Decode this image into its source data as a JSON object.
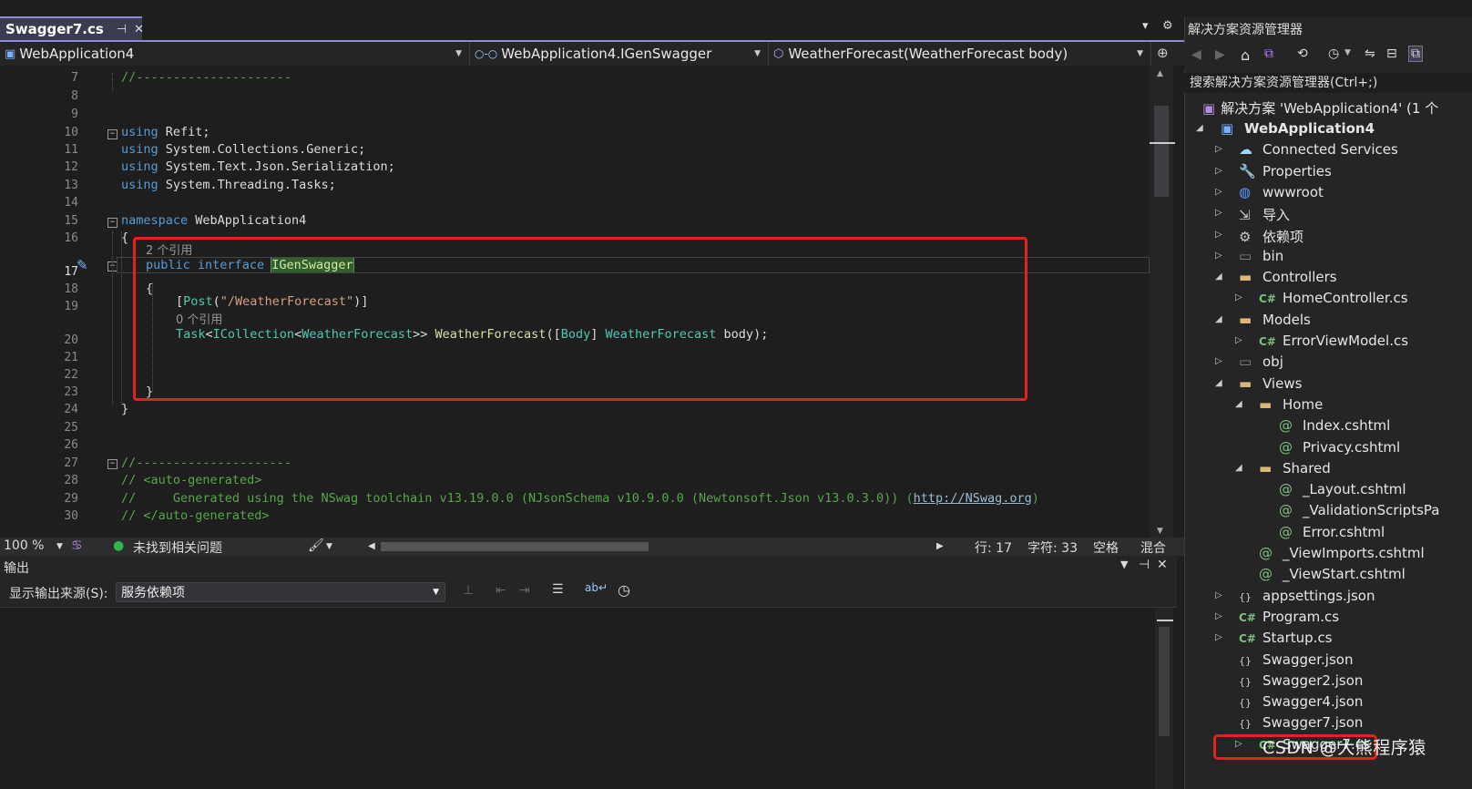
{
  "tabs": [
    {
      "label": "Swagger7.cs",
      "active": true
    }
  ],
  "navbar": {
    "project": "WebApplication4",
    "type": "WebApplication4.IGenSwagger",
    "member": "WeatherForecast(WeatherForecast body)"
  },
  "code": {
    "lines": [
      {
        "n": "7",
        "text": "//---------------------"
      },
      {
        "n": "8",
        "text": ""
      },
      {
        "n": "9",
        "text": ""
      },
      {
        "n": "10",
        "kw": "using",
        "rest": " Refit;"
      },
      {
        "n": "11",
        "kw": "using",
        "rest": " System.Collections.Generic;"
      },
      {
        "n": "12",
        "kw": "using",
        "rest": " System.Text.Json.Serialization;"
      },
      {
        "n": "13",
        "kw": "using",
        "rest": " System.Threading.Tasks;"
      },
      {
        "n": "14",
        "text": ""
      },
      {
        "n": "15",
        "kw": "namespace",
        "rest": " WebApplication4"
      },
      {
        "n": "16",
        "text": "{"
      },
      {
        "n": "17",
        "text": ""
      },
      {
        "n": "18",
        "text": "{"
      },
      {
        "n": "19",
        "text": ""
      },
      {
        "n": "20",
        "text": ""
      },
      {
        "n": "21",
        "text": ""
      },
      {
        "n": "22",
        "text": ""
      },
      {
        "n": "23",
        "text": "}"
      },
      {
        "n": "24",
        "text": "}"
      },
      {
        "n": "25",
        "text": ""
      },
      {
        "n": "26",
        "text": ""
      },
      {
        "n": "27",
        "text": "//---------------------"
      },
      {
        "n": "28",
        "text": "// <auto-generated>"
      },
      {
        "n": "29",
        "text": "//     Generated using the NSwag toolchain v13.19.0.0 (NJsonSchema v10.9.0.0 (Newtonsoft.Json v13.0.3.0)) ("
      },
      {
        "n": "30",
        "text": "// </auto-generated>"
      }
    ],
    "lens_refs_2": "2 个引用",
    "lens_refs_0": "0 个引用",
    "kw_public": "public",
    "kw_interface": "interface",
    "iface_name": "IGenSwagger",
    "attr_post": "Post",
    "attr_route": "\"/WeatherForecast\"",
    "task": "Task",
    "icoll": "ICollection",
    "wf_type": "WeatherForecast",
    "method": "WeatherForecast",
    "body_attr": "Body",
    "param": "body",
    "link": "http://NSwag.org"
  },
  "editor_status": {
    "zoom": "100 %",
    "issues": "未找到相关问题",
    "line": "行: 17",
    "char": "字符: 33",
    "space": "空格",
    "mixed": "混合"
  },
  "output": {
    "title": "输出",
    "source_label": "显示输出来源(S):",
    "source_value": "服务依赖项"
  },
  "solution": {
    "title": "解决方案资源管理器",
    "search": "搜索解决方案资源管理器(Ctrl+;)",
    "root": "解决方案 'WebApplication4' (1 个",
    "items": [
      {
        "label": "WebApplication4",
        "depth": 1,
        "tri": "open",
        "ico": "proj",
        "bold": true
      },
      {
        "label": "Connected Services",
        "depth": 2,
        "tri": "closed",
        "ico": "cloud"
      },
      {
        "label": "Properties",
        "depth": 2,
        "tri": "closed",
        "ico": "wrench"
      },
      {
        "label": "wwwroot",
        "depth": 2,
        "tri": "closed",
        "ico": "globe"
      },
      {
        "label": "导入",
        "depth": 2,
        "tri": "closed",
        "ico": "import"
      },
      {
        "label": "依赖项",
        "depth": 2,
        "tri": "closed",
        "ico": "deps"
      },
      {
        "label": "bin",
        "depth": 2,
        "tri": "closed",
        "ico": "folderdark"
      },
      {
        "label": "Controllers",
        "depth": 2,
        "tri": "open",
        "ico": "folder"
      },
      {
        "label": "HomeController.cs",
        "depth": 3,
        "tri": "closed",
        "ico": "cs"
      },
      {
        "label": "Models",
        "depth": 2,
        "tri": "open",
        "ico": "folder"
      },
      {
        "label": "ErrorViewModel.cs",
        "depth": 3,
        "tri": "closed",
        "ico": "cs"
      },
      {
        "label": "obj",
        "depth": 2,
        "tri": "closed",
        "ico": "folderdark"
      },
      {
        "label": "Views",
        "depth": 2,
        "tri": "open",
        "ico": "folder"
      },
      {
        "label": "Home",
        "depth": 3,
        "tri": "open",
        "ico": "folder"
      },
      {
        "label": "Index.cshtml",
        "depth": 4,
        "tri": "none",
        "ico": "at"
      },
      {
        "label": "Privacy.cshtml",
        "depth": 4,
        "tri": "none",
        "ico": "at"
      },
      {
        "label": "Shared",
        "depth": 3,
        "tri": "open",
        "ico": "folder"
      },
      {
        "label": "_Layout.cshtml",
        "depth": 4,
        "tri": "none",
        "ico": "at"
      },
      {
        "label": "_ValidationScriptsPa",
        "depth": 4,
        "tri": "none",
        "ico": "at"
      },
      {
        "label": "Error.cshtml",
        "depth": 4,
        "tri": "none",
        "ico": "at"
      },
      {
        "label": "_ViewImports.cshtml",
        "depth": 3,
        "tri": "none",
        "ico": "at"
      },
      {
        "label": "_ViewStart.cshtml",
        "depth": 3,
        "tri": "none",
        "ico": "at"
      },
      {
        "label": "appsettings.json",
        "depth": 2,
        "tri": "closed",
        "ico": "json"
      },
      {
        "label": "Program.cs",
        "depth": 2,
        "tri": "closed",
        "ico": "cs"
      },
      {
        "label": "Startup.cs",
        "depth": 2,
        "tri": "closed",
        "ico": "cs"
      },
      {
        "label": "Swagger.json",
        "depth": 2,
        "tri": "none",
        "ico": "json"
      },
      {
        "label": "Swagger2.json",
        "depth": 2,
        "tri": "none",
        "ico": "json"
      },
      {
        "label": "Swagger4.json",
        "depth": 2,
        "tri": "none",
        "ico": "json"
      },
      {
        "label": "Swagger7.json",
        "depth": 2,
        "tri": "none",
        "ico": "json"
      },
      {
        "label": "Swagger7.cs",
        "depth": 3,
        "tri": "closed",
        "ico": "cs"
      }
    ]
  },
  "watermark": "CSDN @大熊程序猿"
}
